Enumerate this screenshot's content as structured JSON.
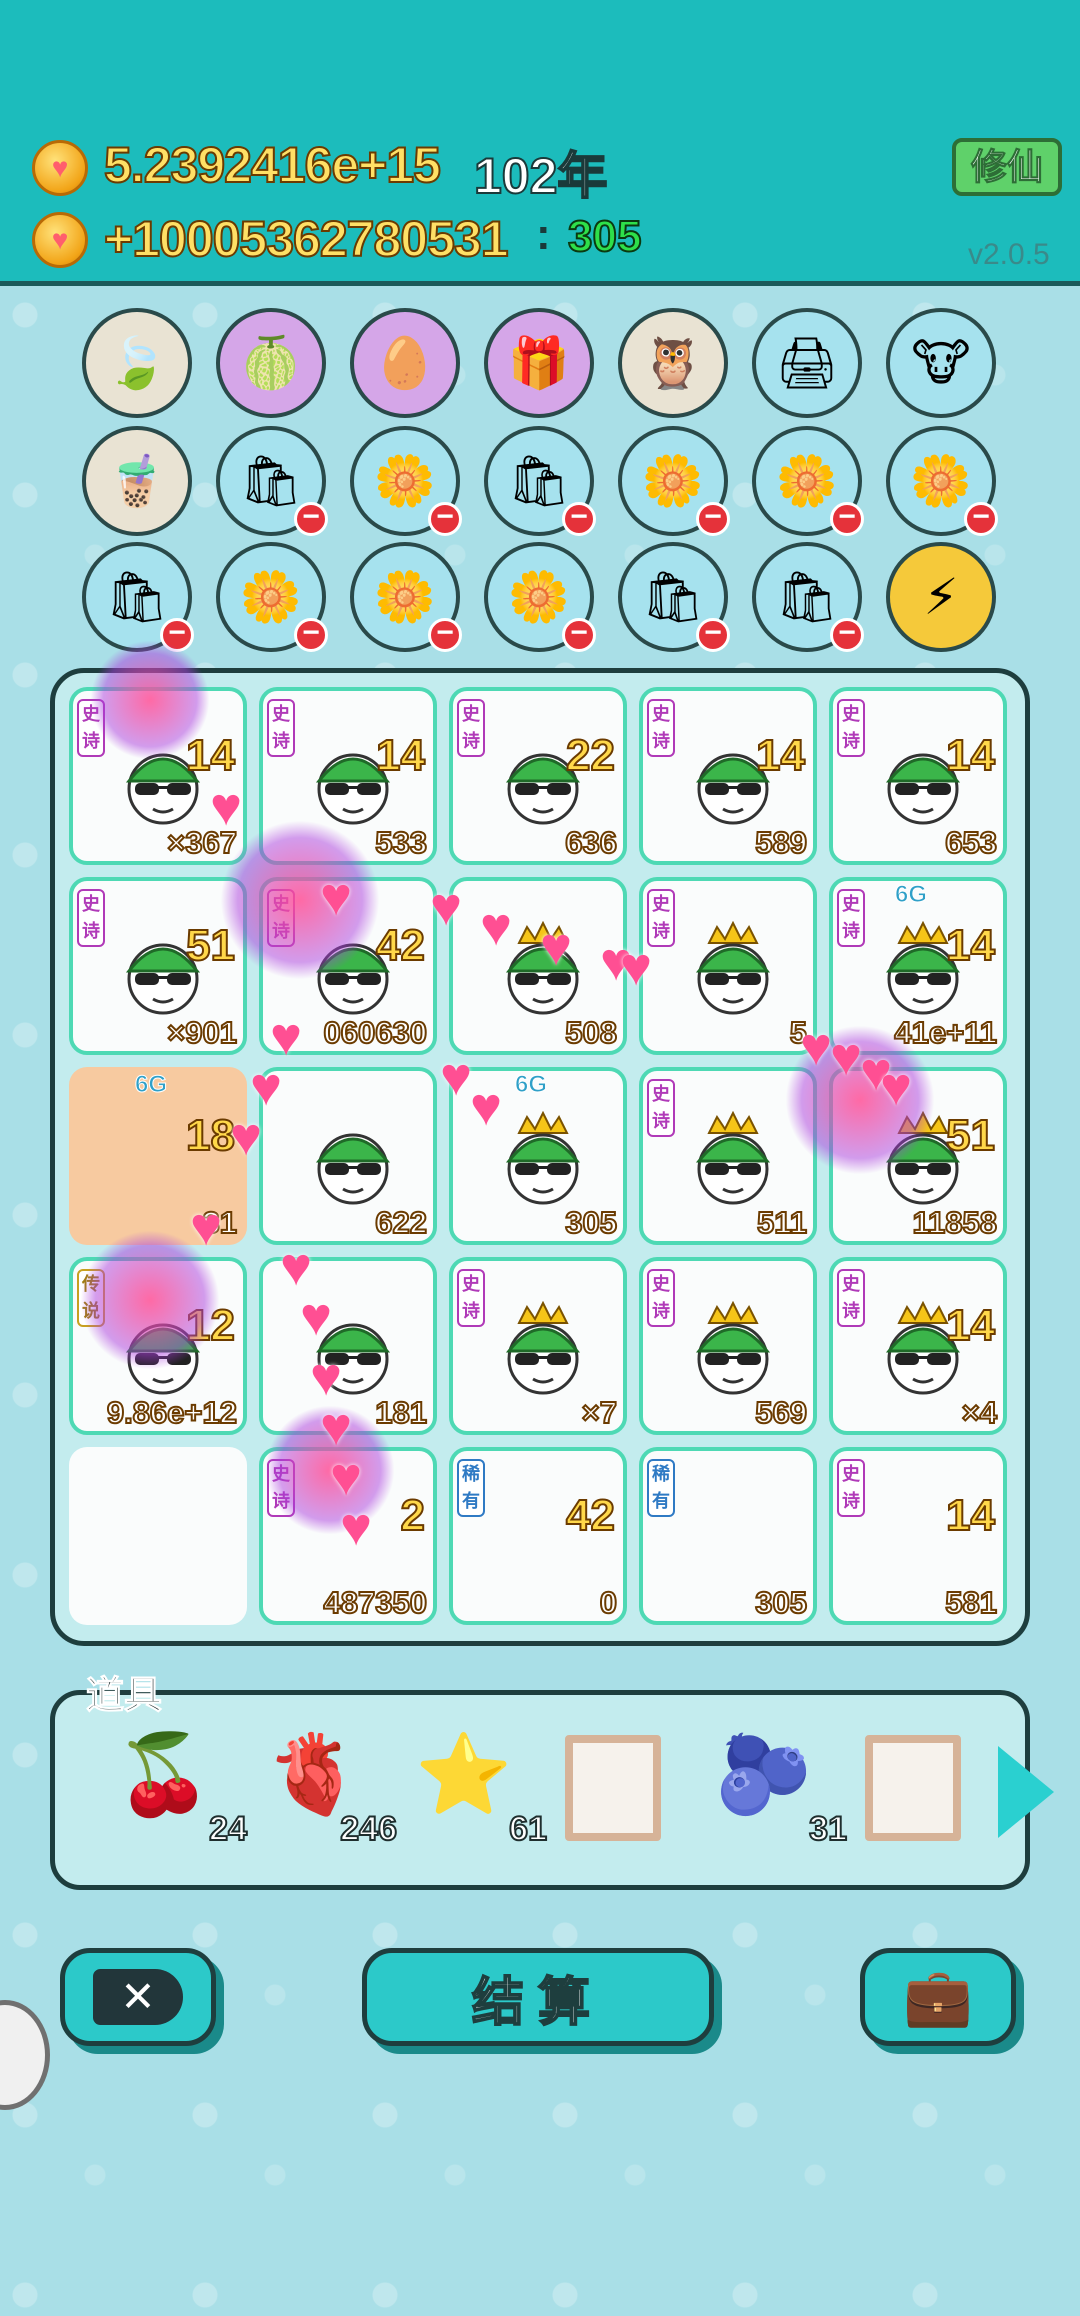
{
  "header": {
    "total_value": "5.2392416e+15",
    "year": "102年",
    "rate_value": "+10005362780531",
    "count_value": "305",
    "xiuxian_label": "修仙",
    "version": "v2.0.5"
  },
  "icon_rows": [
    [
      "leaf",
      "pomelo",
      "egg",
      "gift",
      "owl",
      "printer",
      "cows"
    ],
    [
      "milk-tea",
      "bag",
      "flower",
      "bag",
      "flower",
      "flower",
      "flower"
    ],
    [
      "bag",
      "flower",
      "flower",
      "flower",
      "bag",
      "bag",
      "lightning"
    ]
  ],
  "board": {
    "rows": [
      [
        {
          "tag": "史诗",
          "level": "14",
          "value": "×367"
        },
        {
          "tag": "史诗",
          "level": "14",
          "value": "533"
        },
        {
          "tag": "史诗",
          "level": "22",
          "value": "636"
        },
        {
          "tag": "史诗",
          "level": "14",
          "value": "589"
        },
        {
          "tag": "史诗",
          "level": "14",
          "value": "653"
        }
      ],
      [
        {
          "tag": "史诗",
          "level": "51",
          "value": "×901"
        },
        {
          "tag": "史诗",
          "level": "42",
          "value": "060630"
        },
        {
          "tag": "",
          "level": "",
          "value": "508"
        },
        {
          "tag": "史诗",
          "level": "",
          "value": "5"
        },
        {
          "tag": "史诗",
          "level": "14",
          "value": "41e+11",
          "g": "6G"
        }
      ],
      [
        {
          "tag": "",
          "level": "18",
          "value": "31",
          "g": "6G"
        },
        {
          "tag": "",
          "level": "",
          "value": "622"
        },
        {
          "tag": "",
          "level": "",
          "value": "305",
          "g": "6G"
        },
        {
          "tag": "史诗",
          "level": "",
          "value": "511"
        },
        {
          "tag": "",
          "level": "51",
          "value": "11858"
        }
      ],
      [
        {
          "tag": "传说",
          "level": "12",
          "value": "9.86e+12"
        },
        {
          "tag": "",
          "level": "",
          "value": "181"
        },
        {
          "tag": "史诗",
          "level": "",
          "value": "×7"
        },
        {
          "tag": "史诗",
          "level": "",
          "value": "569"
        },
        {
          "tag": "史诗",
          "level": "14",
          "value": "×4"
        }
      ],
      [
        {
          "tag": "",
          "level": "",
          "value": ""
        },
        {
          "tag": "史诗",
          "level": "2",
          "value": "487350"
        },
        {
          "tag": "稀有",
          "level": "42",
          "value": "0"
        },
        {
          "tag": "稀有",
          "level": "",
          "value": "305"
        },
        {
          "tag": "史诗",
          "level": "14",
          "value": "581"
        }
      ]
    ]
  },
  "props": {
    "label": "道具",
    "items": [
      {
        "icon": "lychee",
        "count": "24"
      },
      {
        "icon": "liver",
        "count": "246"
      },
      {
        "icon": "star",
        "count": "61"
      },
      {
        "icon": "empty-frame",
        "count": ""
      },
      {
        "icon": "blueberry",
        "count": "31"
      },
      {
        "icon": "empty-frame",
        "count": ""
      }
    ]
  },
  "buttons": {
    "close_label": "✕",
    "settle_label": "结算"
  },
  "colors": {
    "header_bg": "#1cbcbc",
    "page_bg": "#a9dfe7",
    "epic_border": "#4ed9b4",
    "coin": "#f2a417"
  }
}
